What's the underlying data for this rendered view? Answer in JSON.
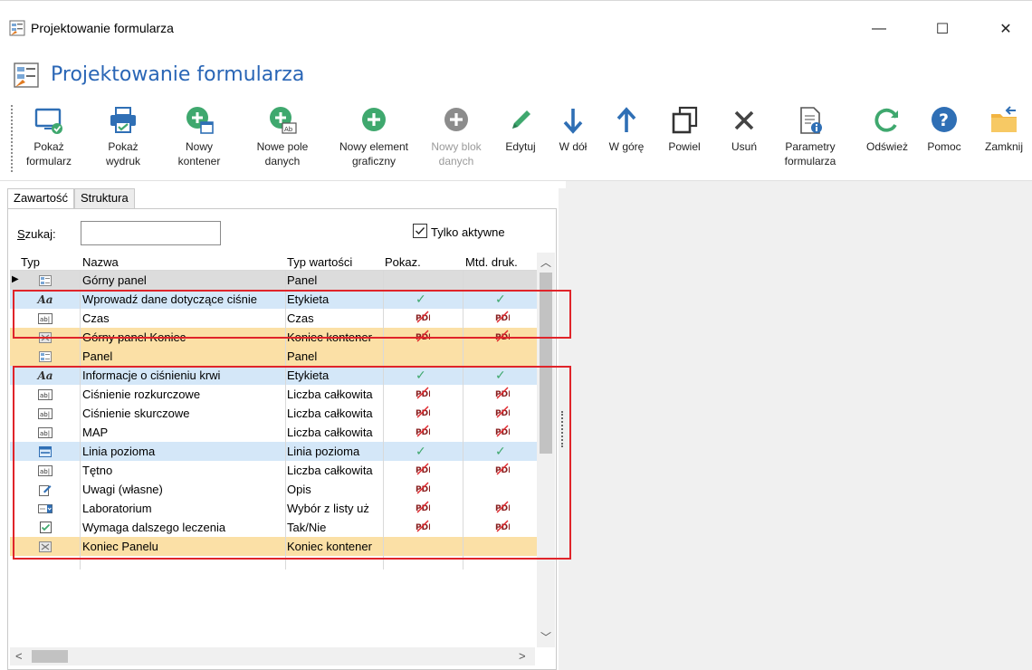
{
  "window": {
    "title": "Projektowanie formularza",
    "min_glyph": "—",
    "max_glyph": "☐",
    "close_glyph": "✕"
  },
  "header": {
    "title": "Projektowanie formularza"
  },
  "ribbon": [
    {
      "id": "show-form",
      "label1": "Pokaż",
      "label2": "formularz",
      "icon": "monitor-check-icon",
      "enabled": true
    },
    {
      "id": "show-print",
      "label1": "Pokaż",
      "label2": "wydruk",
      "icon": "printer-icon",
      "enabled": true
    },
    {
      "id": "new-container",
      "label1": "Nowy",
      "label2": "kontener",
      "icon": "add-container-icon",
      "enabled": true
    },
    {
      "id": "new-data-field",
      "label1": "Nowe pole",
      "label2": "danych",
      "icon": "add-field-icon",
      "enabled": true
    },
    {
      "id": "new-graphic",
      "label1": "Nowy element",
      "label2": "graficzny",
      "icon": "add-icon",
      "enabled": true
    },
    {
      "id": "new-data-block",
      "label1": "Nowy blok",
      "label2": "danych",
      "icon": "add-icon",
      "enabled": false
    },
    {
      "id": "edit",
      "label1": "Edytuj",
      "label2": "",
      "icon": "pencil-icon",
      "enabled": true
    },
    {
      "id": "down",
      "label1": "W dół",
      "label2": "",
      "icon": "arrow-down-icon",
      "enabled": true
    },
    {
      "id": "up",
      "label1": "W górę",
      "label2": "",
      "icon": "arrow-up-icon",
      "enabled": true
    },
    {
      "id": "duplicate",
      "label1": "Powiel",
      "label2": "",
      "icon": "duplicate-icon",
      "enabled": true
    },
    {
      "id": "delete",
      "label1": "Usuń",
      "label2": "",
      "icon": "delete-x-icon",
      "enabled": true
    },
    {
      "id": "form-params",
      "label1": "Parametry",
      "label2": "formularza",
      "icon": "document-info-icon",
      "enabled": true
    },
    {
      "id": "refresh",
      "label1": "Odśwież",
      "label2": "",
      "icon": "refresh-icon",
      "enabled": true
    },
    {
      "id": "help",
      "label1": "Pomoc",
      "label2": "",
      "icon": "help-icon",
      "enabled": true
    },
    {
      "id": "close",
      "label1": "Zamknij",
      "label2": "",
      "icon": "close-folder-icon",
      "enabled": true
    }
  ],
  "tabs": [
    "Zawartość",
    "Struktura"
  ],
  "search": {
    "label_prefix": "S",
    "label_rest": "zukaj:",
    "value": ""
  },
  "active_only": {
    "label": "Tylko aktywne",
    "checked": true
  },
  "columns": [
    "Typ",
    "Nazwa",
    "Typ wartości",
    "Pokaz.",
    "Mtd. druk."
  ],
  "rows": [
    {
      "icon": "panel-icon",
      "name": "Górny panel",
      "type": "Panel",
      "show": "",
      "print": "",
      "style": "gray",
      "current": true
    },
    {
      "icon": "label-aa-icon",
      "name": "Wprowadź dane dotyczące ciśnie",
      "type": "Etykieta",
      "show": "check",
      "print": "check",
      "style": "blue"
    },
    {
      "icon": "textbox-icon",
      "name": "Czas",
      "type": "Czas",
      "show": "pdf",
      "print": "pdf",
      "style": "white"
    },
    {
      "icon": "container-end-icon",
      "name": "Górny panel Koniec",
      "type": "Koniec kontener",
      "show": "pdf",
      "print": "pdf",
      "style": "orange"
    },
    {
      "icon": "panel-icon",
      "name": "Panel",
      "type": "Panel",
      "show": "",
      "print": "",
      "style": "orange"
    },
    {
      "icon": "label-aa-icon",
      "name": "Informacje o ciśnieniu krwi",
      "type": "Etykieta",
      "show": "check",
      "print": "check",
      "style": "blue"
    },
    {
      "icon": "textbox-icon",
      "name": "Ciśnienie rozkurczowe",
      "type": "Liczba całkowita",
      "show": "pdf",
      "print": "pdf",
      "style": "white"
    },
    {
      "icon": "textbox-icon",
      "name": "Ciśnienie skurczowe",
      "type": "Liczba całkowita",
      "show": "pdf",
      "print": "pdf",
      "style": "white"
    },
    {
      "icon": "textbox-icon",
      "name": "MAP",
      "type": "Liczba całkowita",
      "show": "pdf",
      "print": "pdf",
      "style": "white"
    },
    {
      "icon": "horizontal-line-icon",
      "name": "Linia pozioma",
      "type": "Linia pozioma",
      "show": "check",
      "print": "check",
      "style": "blue"
    },
    {
      "icon": "textbox-icon",
      "name": "Tętno",
      "type": "Liczba całkowita",
      "show": "pdf",
      "print": "pdf",
      "style": "white"
    },
    {
      "icon": "note-edit-icon",
      "name": "Uwagi (własne)",
      "type": "Opis",
      "show": "pdf",
      "print": "",
      "style": "white"
    },
    {
      "icon": "dropdown-list-icon",
      "name": "Laboratorium",
      "type": "Wybór z listy uż",
      "show": "pdf",
      "print": "pdf",
      "style": "white"
    },
    {
      "icon": "checkbox-icon",
      "name": "Wymaga dalszego leczenia",
      "type": "Tak/Nie",
      "show": "pdf",
      "print": "pdf",
      "style": "white"
    },
    {
      "icon": "container-end-icon",
      "name": "Koniec Panelu",
      "type": "Koniec kontener",
      "show": "",
      "print": "",
      "style": "orange"
    }
  ],
  "colors": {
    "accent_title": "#2a66b6",
    "highlight_box": "#e0242a",
    "row_blue": "#d4e7f8",
    "row_orange": "#fbe0a6",
    "check_green": "#3fa86e"
  }
}
